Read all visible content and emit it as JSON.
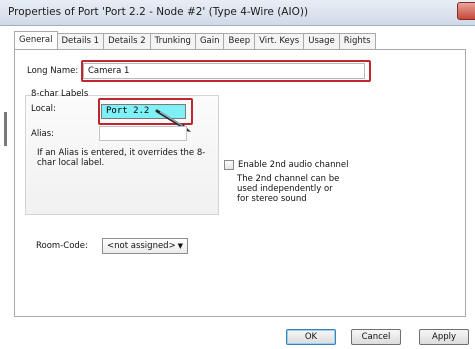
{
  "window": {
    "title": "Properties of Port 'Port 2.2 - Node #2' (Type 4-Wire (AIO))"
  },
  "tabs": [
    {
      "label": "General"
    },
    {
      "label": "Details 1"
    },
    {
      "label": "Details 2"
    },
    {
      "label": "Trunking"
    },
    {
      "label": "Gain"
    },
    {
      "label": "Beep"
    },
    {
      "label": "Virt. Keys"
    },
    {
      "label": "Usage"
    },
    {
      "label": "Rights"
    }
  ],
  "active_tab": "General",
  "general": {
    "long_name_label": "Long Name:",
    "long_name_value": "Camera 1",
    "labels_group_title": "8-char Labels",
    "local_label": "Local:",
    "local_value": "Port 2.2",
    "alias_label": "Alias:",
    "alias_value": "",
    "alias_help": "If an Alias is entered, it overrides the 8-char local label.",
    "audio_checkbox_label": "Enable 2nd audio channel",
    "audio_checkbox_checked": false,
    "audio_note": "The 2nd channel can be used independently or for stereo sound",
    "room_code_label": "Room-Code:",
    "room_code_value": "<not assigned>"
  },
  "buttons": {
    "ok": "OK",
    "cancel": "Cancel",
    "apply": "Apply"
  },
  "colors": {
    "highlight_box": "#c0262d",
    "local_field_bg": "#7ff1f6"
  }
}
